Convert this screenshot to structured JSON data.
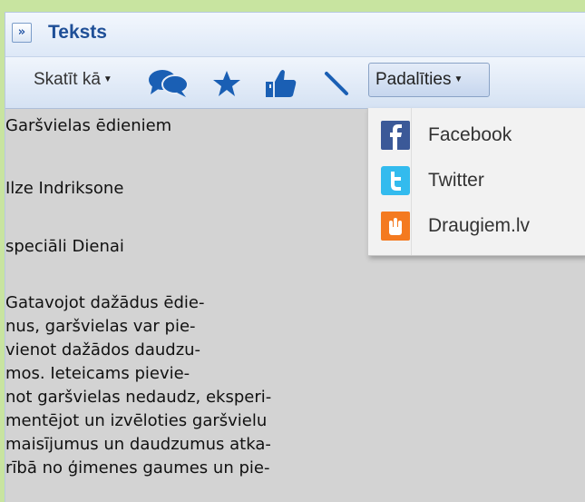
{
  "panel": {
    "expand_glyph": "»",
    "title": "Teksts"
  },
  "toolbar": {
    "view_as_label": "Skatīt kā",
    "share_label": "Padalīties",
    "icons": [
      "comments-icon",
      "star-icon",
      "thumbs-up-icon",
      "pen-icon"
    ]
  },
  "share_menu": {
    "items": [
      {
        "label": "Facebook",
        "icon": "facebook-icon",
        "color": "#3b5998"
      },
      {
        "label": "Twitter",
        "icon": "twitter-icon",
        "color": "#33bbee"
      },
      {
        "label": "Draugiem.lv",
        "icon": "draugiem-icon",
        "color": "#f47a20"
      }
    ]
  },
  "article": {
    "title": "Garšvielas ēdieniem",
    "author": "Ilze Indriksone",
    "byline": "speciāli Dienai",
    "body_lines": [
      "Gatavojot dažādus ēdie-",
      "nus, garšvielas var pie-",
      "vienot dažādos daudzu-",
      "mos. Ieteicams pievie-",
      "not garšvielas nedaudz, eksperi-",
      "mentējot un izvēloties garšvielu",
      "maisījumus un daudzumus atka-",
      "rībā no ģimenes gaumes un pie-"
    ]
  },
  "colors": {
    "page_background": "#c8e4a0",
    "content_background": "#d3d3d3",
    "title_color": "#1f4f97",
    "icon_blue": "#1a5fb4"
  }
}
